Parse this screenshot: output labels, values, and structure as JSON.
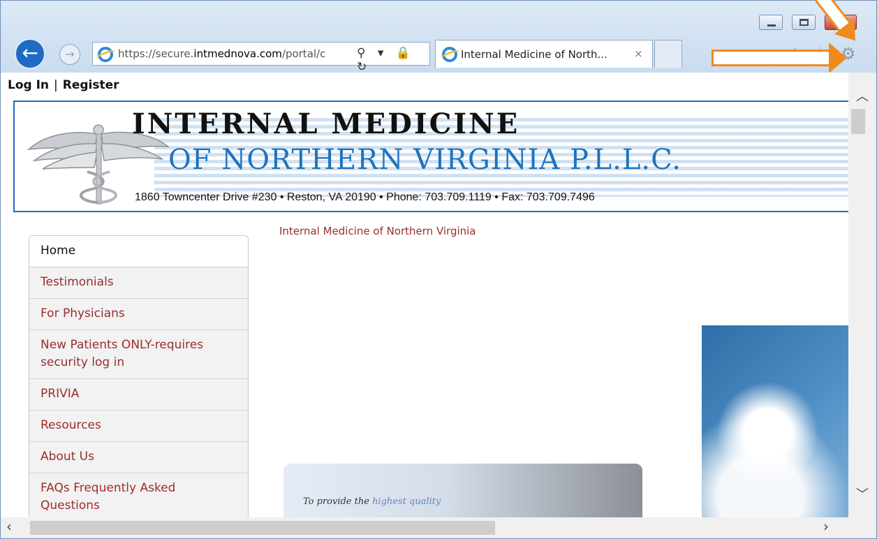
{
  "browser": {
    "url_prefix": "https://secure.",
    "url_domain": "intmednova.com",
    "url_rest": "/portal/c",
    "tab_title": "Internal Medicine of North...",
    "tab_close": "×",
    "address_icons": "⚲ ▾ 🔒 ↻"
  },
  "page": {
    "login": "Log In",
    "register": "Register",
    "separator": "|",
    "breadcrumb": "Internal Medicine of Northern Virginia",
    "banner": {
      "line1": "INTERNAL MEDICINE",
      "line2": "OF NORTHERN VIRGINIA P.L.L.C.",
      "line3": "1860 Towncenter Drive #230 • Reston, VA 20190 • Phone: 703.709.1119 • Fax: 703.709.7496"
    },
    "nav": [
      {
        "label": "Home"
      },
      {
        "label": "Testimonials"
      },
      {
        "label": "For Physicians"
      },
      {
        "label": "New Patients ONLY-requires security log in"
      },
      {
        "label": "PRIVIA"
      },
      {
        "label": "Resources"
      },
      {
        "label": "About Us"
      },
      {
        "label": "FAQs Frequently Asked Questions"
      }
    ],
    "mission": {
      "prefix": "To provide the ",
      "emphasis": "highest quality"
    }
  },
  "icons": {
    "back": "back-arrow-icon",
    "forward": "forward-arrow-icon",
    "settings": "gear-icon",
    "annotation": "orange-arrow-annotation"
  },
  "colors": {
    "accent": "#1f6ac4",
    "nav_link": "#9b2c2c",
    "annotation": "#f08a1f"
  }
}
